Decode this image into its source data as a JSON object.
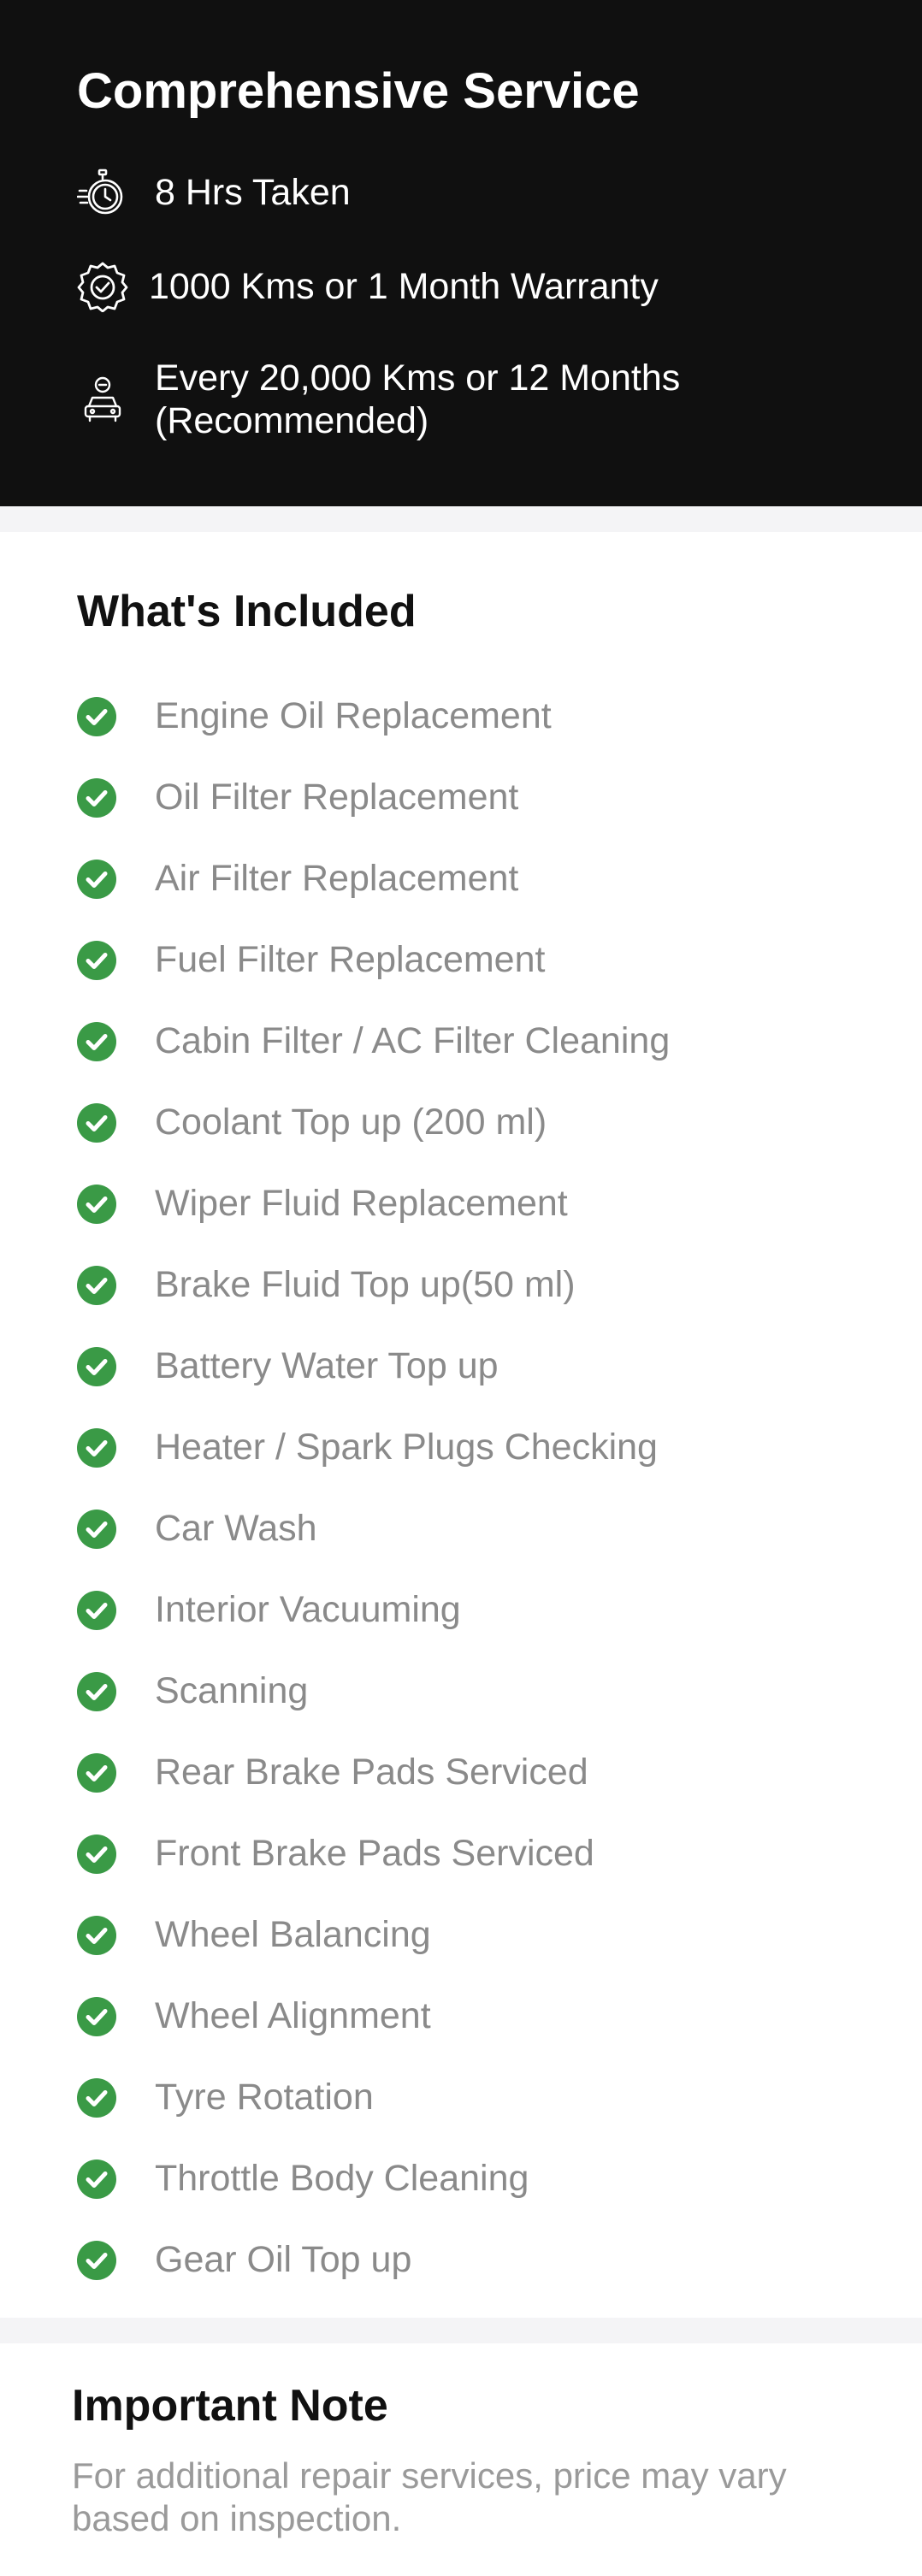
{
  "header": {
    "title": "Comprehensive Service",
    "meta": [
      {
        "icon": "stopwatch-icon",
        "text": "8 Hrs Taken"
      },
      {
        "icon": "warranty-badge-icon",
        "text": "1000 Kms or 1 Month Warranty"
      },
      {
        "icon": "car-service-icon",
        "text": "Every 20,000 Kms or 12 Months\n(Recommended)"
      }
    ]
  },
  "included": {
    "title": "What's Included",
    "icon": "check-circle-icon",
    "accent_color": "#3a9a46",
    "items": [
      "Engine Oil Replacement",
      "Oil Filter Replacement",
      "Air Filter Replacement",
      "Fuel Filter Replacement",
      "Cabin Filter / AC Filter Cleaning",
      "Coolant Top up (200 ml)",
      "Wiper Fluid Replacement",
      "Brake Fluid Top up(50 ml)",
      "Battery Water Top up",
      "Heater / Spark Plugs Checking",
      "Car Wash",
      "Interior Vacuuming",
      "Scanning",
      "Rear Brake Pads Serviced",
      "Front Brake Pads Serviced",
      "Wheel Balancing",
      "Wheel Alignment",
      "Tyre Rotation",
      "Throttle Body Cleaning",
      "Gear Oil Top up"
    ]
  },
  "note": {
    "title": "Important Note",
    "text": "For additional repair services, price may vary based on inspection."
  }
}
